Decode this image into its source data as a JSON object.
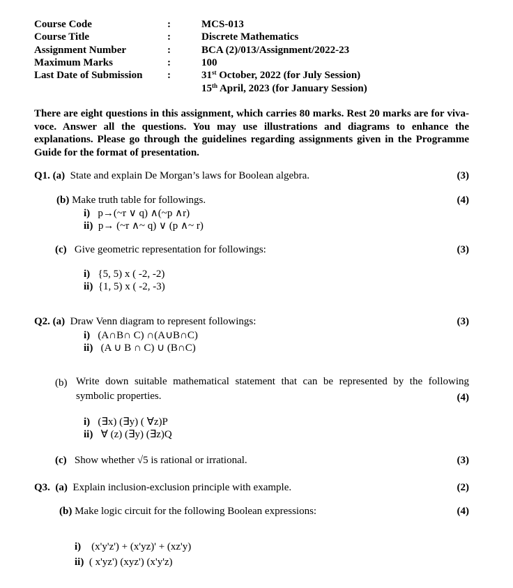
{
  "header": {
    "rows": [
      {
        "label": "Course Code",
        "value": "MCS-013"
      },
      {
        "label": "Course Title",
        "value": "Discrete Mathematics"
      },
      {
        "label": "Assignment Number",
        "value": "BCA (2)/013/Assignment/2022-23"
      },
      {
        "label": "Maximum Marks",
        "value": "100"
      },
      {
        "label": "Last Date of Submission",
        "value": ""
      }
    ],
    "colon": ":",
    "dates": [
      {
        "day": "31",
        "suffix": "st",
        "rest": " October, 2022 (for July Session)"
      },
      {
        "day": "15",
        "suffix": "th",
        "rest": " April, 2023 (for January Session)"
      }
    ]
  },
  "intro": "There are eight questions in this assignment, which carries 80 marks. Rest 20 marks are for viva-voce. Answer all the questions. You may use illustrations and diagrams to enhance the explanations. Please go through the guidelines regarding assignments given in the Programme Guide for the format of presentation.",
  "questions": {
    "q1": {
      "num": "Q1.",
      "a": {
        "label": "(a)",
        "text": "State and explain De Morgan’s laws for Boolean algebra.",
        "marks": "(3)"
      },
      "b": {
        "label": "(b)",
        "text": "Make truth table for followings.",
        "marks": "(4)",
        "items": [
          {
            "label": "i)",
            "text": "p→(~r  ∨  q) ∧(~p ∧r)"
          },
          {
            "label": "ii)",
            "text": "p→ (~r  ∧~ q) ∨  (p ∧~ r)"
          }
        ]
      },
      "c": {
        "label": "(c)",
        "text": "Give geometric representation for followings:",
        "marks": "(3)",
        "items": [
          {
            "label": "i)",
            "text": "{5, 5) x ( -2, -2)"
          },
          {
            "label": "ii)",
            "text": "{1, 5) x ( -2, -3)"
          }
        ]
      }
    },
    "q2": {
      "num": "Q2.",
      "a": {
        "label": "(a)",
        "text": "Draw Venn diagram to represent followings:",
        "marks": "(3)",
        "items": [
          {
            "label": "i)",
            "text": "(A∩B∩ C) ∩(A∪B∩C)"
          },
          {
            "label": "ii)",
            "text": "(A ∪ B ∩ C) ∪ (B∩C)"
          }
        ]
      },
      "b": {
        "label": "(b)",
        "text": "Write down suitable mathematical statement that can be represented by the following symbolic properties.",
        "marks": "(4)",
        "items": [
          {
            "label": "i)",
            "text": "(∃x) (∃y) ( ∀z)P"
          },
          {
            "label": "ii)",
            "text": "∀ (z) (∃y) (∃z)Q"
          }
        ]
      },
      "c": {
        "label": "(c)",
        "text": "Show whether √5  is rational or irrational.",
        "marks": "(3)"
      }
    },
    "q3": {
      "num": "Q3.",
      "a": {
        "label": "(a)",
        "text": "Explain inclusion-exclusion principle with example.",
        "marks": "(2)"
      },
      "b": {
        "label": "(b)",
        "text": "Make logic circuit for the following Boolean expressions:",
        "marks": "(4)",
        "items": [
          {
            "label": "i)",
            "text": "(x'y'z') + (x'yz)' + (xz'y)"
          },
          {
            "label": "ii)",
            "text": "( x'yz') (xyz') (x'y'z)"
          }
        ]
      }
    }
  }
}
